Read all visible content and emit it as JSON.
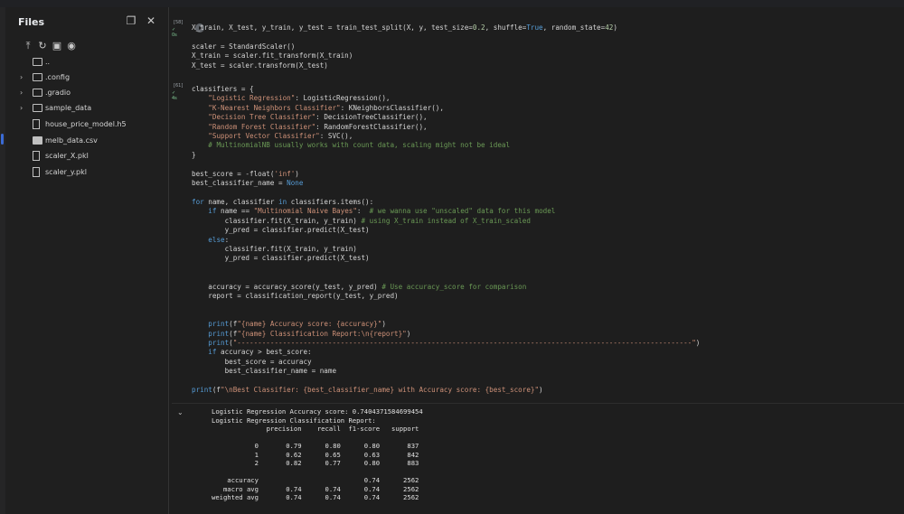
{
  "files_panel": {
    "title": "Files",
    "items": [
      {
        "name": "..",
        "type": "folder",
        "expandable": false
      },
      {
        "name": ".config",
        "type": "folder",
        "expandable": true
      },
      {
        "name": ".gradio",
        "type": "folder",
        "expandable": true
      },
      {
        "name": "sample_data",
        "type": "folder",
        "expandable": true
      },
      {
        "name": "house_price_model.h5",
        "type": "file",
        "expandable": false
      },
      {
        "name": "melb_data.csv",
        "type": "csv",
        "expandable": false
      },
      {
        "name": "scaler_X.pkl",
        "type": "file",
        "expandable": false
      },
      {
        "name": "scaler_y.pkl",
        "type": "file",
        "expandable": false
      }
    ],
    "toolbar_icons": [
      "upload-icon",
      "refresh-icon",
      "new-folder-icon",
      "visibility-icon"
    ]
  },
  "cells": [
    {
      "exec_count": "[58]",
      "status": "✓ 0s",
      "code": "X_train, X_test, y_train, y_test = train_test_split(X, y, test_size=0.2, shuffle=True, random_state=42)\n\nscaler = StandardScaler()\nX_train = scaler.fit_transform(X_train)\nX_test = scaler.transform(X_test)"
    },
    {
      "exec_count": "[61]",
      "status": "✓ 4s",
      "code": "classifiers = {\n    \"Logistic Regression\": LogisticRegression(),\n    \"K-Nearest Neighbors Classifier\": KNeighborsClassifier(),\n    \"Decision Tree Classifier\": DecisionTreeClassifier(),\n    \"Random Forest Classifier\": RandomForestClassifier(),\n    \"Support Vector Classifier\": SVC(),\n    # MultinomialNB usually works with count data, scaling might not be ideal\n}\n\nbest_score = -float('inf')\nbest_classifier_name = None\n\nfor name, classifier in classifiers.items():\n    if name == \"Multinomial Naive Bayes\":  # we wanna use \"unscaled\" data for this model\n        classifier.fit(X_train, y_train) # using X_train instead of X_train_scaled\n        y_pred = classifier.predict(X_test)\n    else:\n        classifier.fit(X_train, y_train)\n        y_pred = classifier.predict(X_test)\n\n\n    accuracy = accuracy_score(y_test, y_pred) # Use accuracy_score for comparison\n    report = classification_report(y_test, y_pred)\n\n\n    print(f\"{name} Accuracy score: {accuracy}\")\n    print(f\"{name} Classification Report:\\n{report}\")\n    print(\"--------------------------------------------------------------------------------------------------------------\")\n    if accuracy > best_score:\n        best_score = accuracy\n        best_classifier_name = name\n\nprint(f\"\\nBest Classifier: {best_classifier_name} with Accuracy score: {best_score}\")",
      "output": "Logistic Regression Accuracy score: 0.7404371584699454\nLogistic Regression Classification Report:\n              precision    recall  f1-score   support\n\n           0       0.79      0.80      0.80       837\n           1       0.62      0.65      0.63       842\n           2       0.82      0.77      0.80       883\n\n    accuracy                           0.74      2562\n   macro avg       0.74      0.74      0.74      2562\nweighted avg       0.74      0.74      0.74      2562"
    }
  ]
}
